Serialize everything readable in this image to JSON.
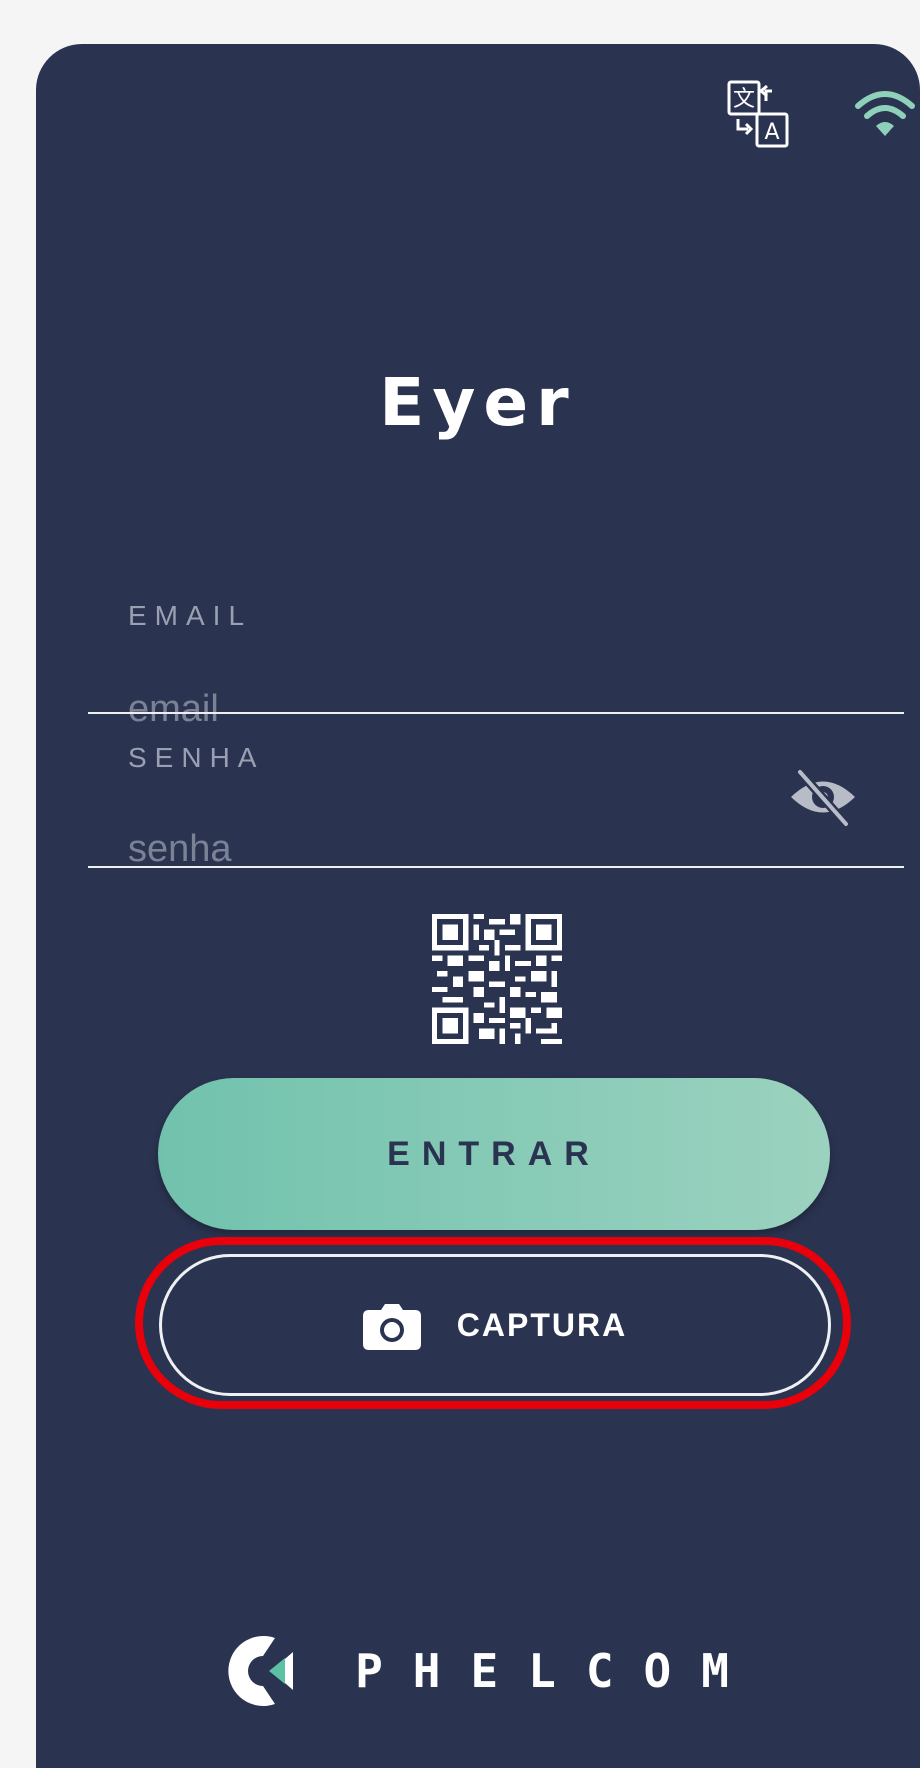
{
  "app": {
    "title": "Eyer"
  },
  "header": {
    "icons": [
      "translate-icon",
      "wifi-icon"
    ]
  },
  "login": {
    "email_label": "EMAIL",
    "email_placeholder": "email",
    "password_label": "SENHA",
    "password_placeholder": "senha",
    "password_toggle_icon": "eye-off-icon",
    "qr_icon": "qr-code-icon"
  },
  "actions": {
    "enter_label": "ENTRAR",
    "capture_label": "CAPTURA",
    "capture_icon": "camera-icon"
  },
  "footer": {
    "brand_name": "PHELCOM",
    "logo_icon": "phelcom-logo"
  },
  "colors": {
    "background": "#2a3350",
    "accent": "#71c2ad",
    "highlight": "#e8000b"
  }
}
